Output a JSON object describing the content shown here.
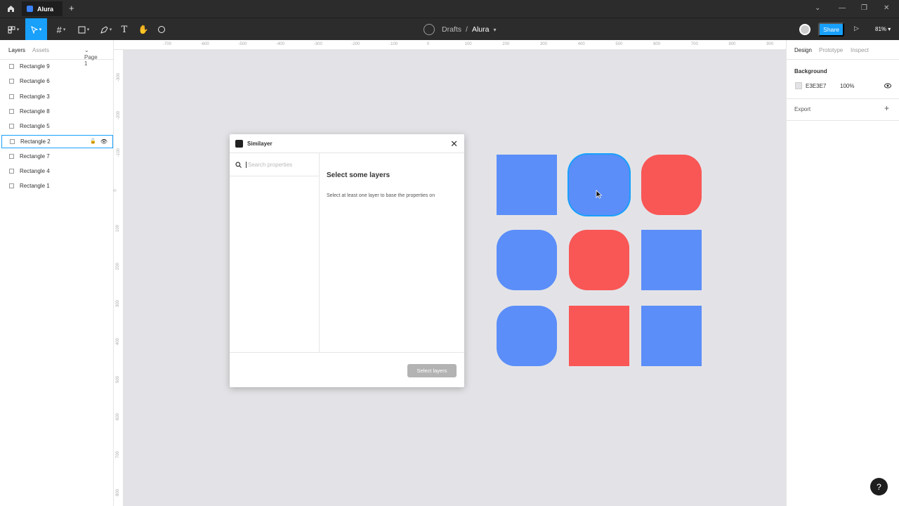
{
  "titlebar": {
    "tab_title": "Alura",
    "new_tab": "+"
  },
  "toolbar": {
    "breadcrumb_team": "Drafts",
    "breadcrumb_sep": "/",
    "file_name": "Alura",
    "share_label": "Share",
    "zoom_label": "81%"
  },
  "left_panel": {
    "tab_layers": "Layers",
    "tab_assets": "Assets",
    "page_label": "Page 1",
    "layers": [
      {
        "label": "Rectangle 9"
      },
      {
        "label": "Rectangle 6"
      },
      {
        "label": "Rectangle 3"
      },
      {
        "label": "Rectangle 8"
      },
      {
        "label": "Rectangle 5"
      },
      {
        "label": "Rectangle 2"
      },
      {
        "label": "Rectangle 7"
      },
      {
        "label": "Rectangle 4"
      },
      {
        "label": "Rectangle 1"
      }
    ],
    "selected_index": 5
  },
  "ruler": {
    "top_ticks": [
      "-700",
      "-600",
      "-500",
      "-400",
      "-300",
      "-200",
      "-100",
      "0",
      "100",
      "200",
      "300",
      "400",
      "500",
      "600",
      "700",
      "800",
      "900"
    ],
    "left_ticks": [
      "-300",
      "-200",
      "-100",
      "0",
      "100",
      "200",
      "300",
      "400",
      "500",
      "600",
      "700",
      "800"
    ]
  },
  "right_panel": {
    "tab_design": "Design",
    "tab_prototype": "Prototype",
    "tab_inspect": "Inspect",
    "background_title": "Background",
    "background_hex": "E3E3E7",
    "background_opacity": "100%",
    "export_title": "Export",
    "export_add": "+"
  },
  "plugin": {
    "title": "Similayer",
    "search_placeholder": "Search properties",
    "heading": "Select some layers",
    "message": "Select at least one layer to base the properties on",
    "button_label": "Select layers"
  },
  "canvas": {
    "background": "#E3E3E7",
    "colors": {
      "blue": "#5b8ef8",
      "red": "#f95656",
      "selection": "#18a0fb"
    },
    "shapes": [
      {
        "color": "blue",
        "rounded": false
      },
      {
        "color": "blue",
        "rounded": true,
        "selected": true
      },
      {
        "color": "red",
        "rounded": true
      },
      {
        "color": "blue",
        "rounded": true
      },
      {
        "color": "red",
        "rounded": true
      },
      {
        "color": "blue",
        "rounded": false
      },
      {
        "color": "blue",
        "rounded": true
      },
      {
        "color": "red",
        "rounded": false
      },
      {
        "color": "blue",
        "rounded": false
      }
    ]
  },
  "help_label": "?"
}
